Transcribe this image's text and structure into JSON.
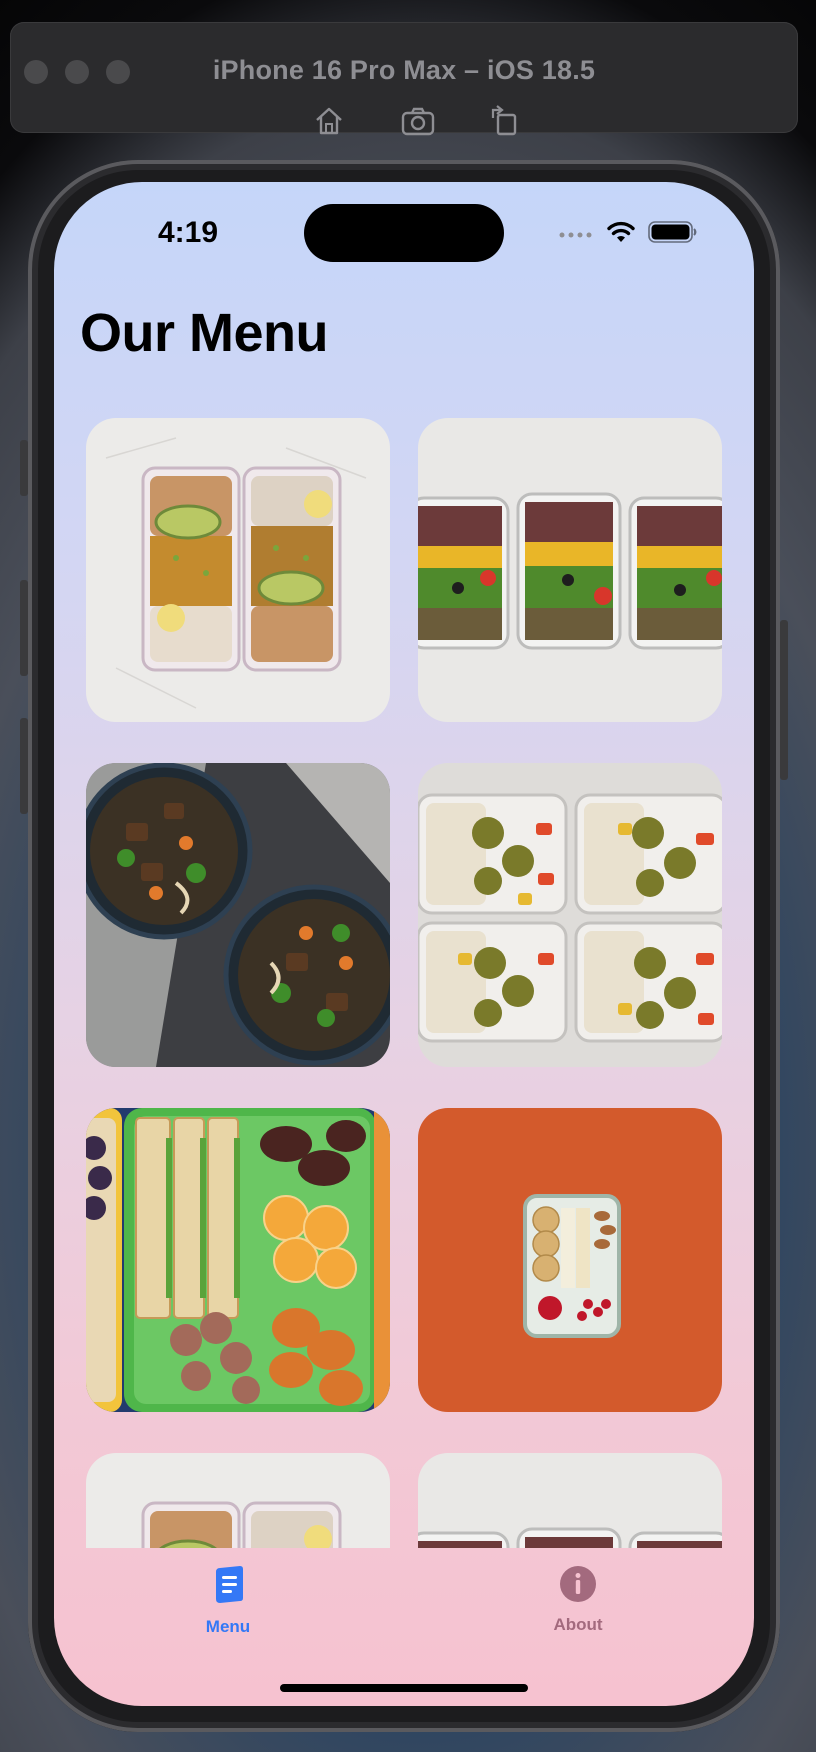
{
  "simulator": {
    "title": "iPhone 16 Pro Max – iOS 18.5",
    "buttons": [
      "home-icon",
      "screenshot-icon",
      "rotate-icon"
    ]
  },
  "status_bar": {
    "time": "4:19",
    "icons": [
      "cellular-icon",
      "wifi-icon",
      "battery-icon"
    ]
  },
  "page": {
    "title": "Our Menu"
  },
  "menu_items": [
    {
      "image": "chickpea-avocado-bento"
    },
    {
      "image": "rice-salad-meal-prep"
    },
    {
      "image": "noodle-soup-bowls"
    },
    {
      "image": "falafel-veggie-boxes"
    },
    {
      "image": "sandwich-fruit-lunchbox"
    },
    {
      "image": "crackers-box-on-orange"
    },
    {
      "image": "chickpea-avocado-bento"
    },
    {
      "image": "rice-salad-meal-prep"
    }
  ],
  "tab_bar": {
    "tabs": [
      {
        "label": "Menu",
        "icon": "book-icon",
        "selected": true,
        "color": "#3478f6"
      },
      {
        "label": "About",
        "icon": "info-icon",
        "selected": false,
        "color": "#a36a7e"
      }
    ]
  }
}
